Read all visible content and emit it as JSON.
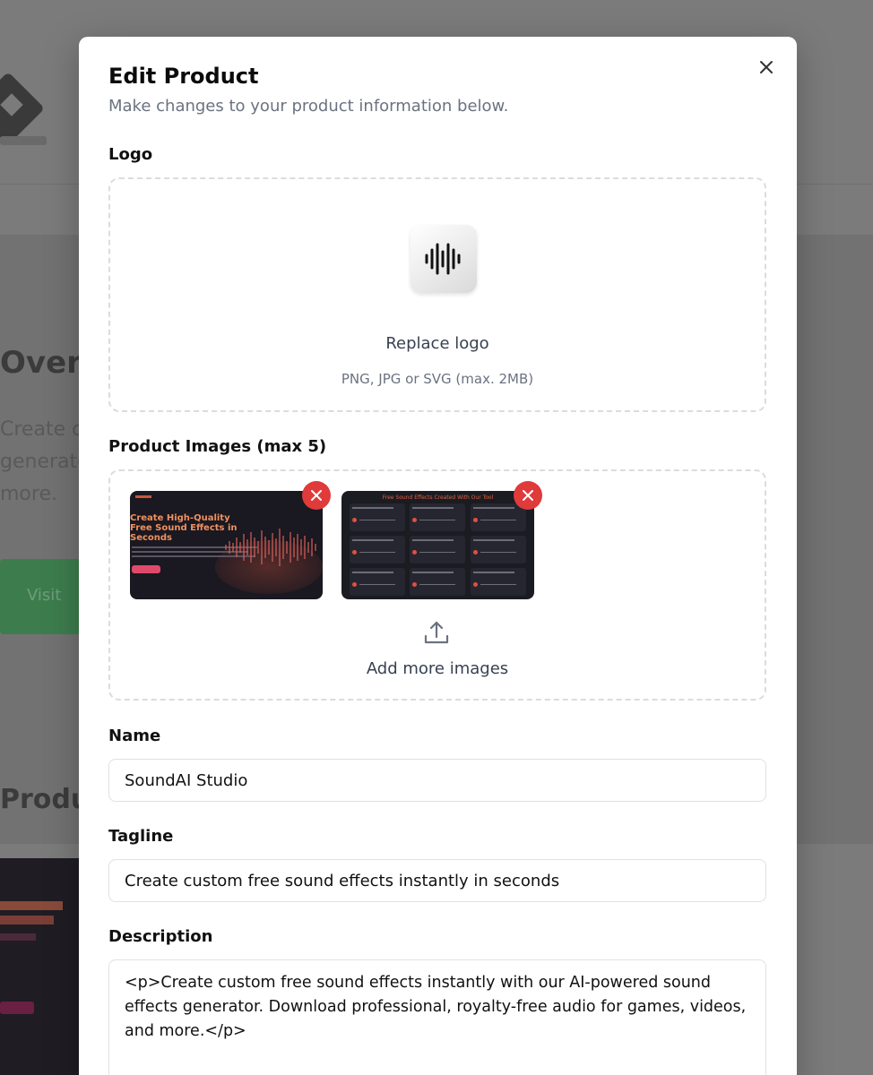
{
  "modal": {
    "title": "Edit Product",
    "description": "Make changes to your product information below.",
    "close_icon": "close-icon"
  },
  "logo": {
    "label": "Logo",
    "replace_text": "Replace logo",
    "formats_text": "PNG, JPG or SVG (max. 2MB)",
    "icon": "soundwave-icon"
  },
  "images": {
    "label": "Product Images (max 5)",
    "thumbnails": [
      {
        "headline_lines": [
          "Create High-Quality",
          "Free Sound Effects in",
          "Seconds"
        ]
      },
      {
        "headline": "Free Sound Effects Created With Our Tool"
      }
    ],
    "add_more_text": "Add more images",
    "upload_icon": "upload-icon",
    "remove_icon": "x-icon"
  },
  "name": {
    "label": "Name",
    "value": "SoundAI Studio"
  },
  "tagline": {
    "label": "Tagline",
    "value": "Create custom free sound effects instantly in seconds"
  },
  "description": {
    "label": "Description",
    "value": "<p>Create custom free sound effects instantly with our AI-powered sound effects generator. Download professional, royalty-free audio for games, videos, and more.</p>"
  },
  "background": {
    "heading_fragment": "Overvie",
    "paragraph_fragment": [
      "Create cus",
      "generato",
      "more."
    ],
    "button_fragment": "Visit",
    "heading2_fragment": "Product"
  },
  "colors": {
    "overlay": "#7b7b7b",
    "remove_button": "#e03a3a",
    "dashed_border": "#d9dce1",
    "muted_text": "#6b7280"
  }
}
